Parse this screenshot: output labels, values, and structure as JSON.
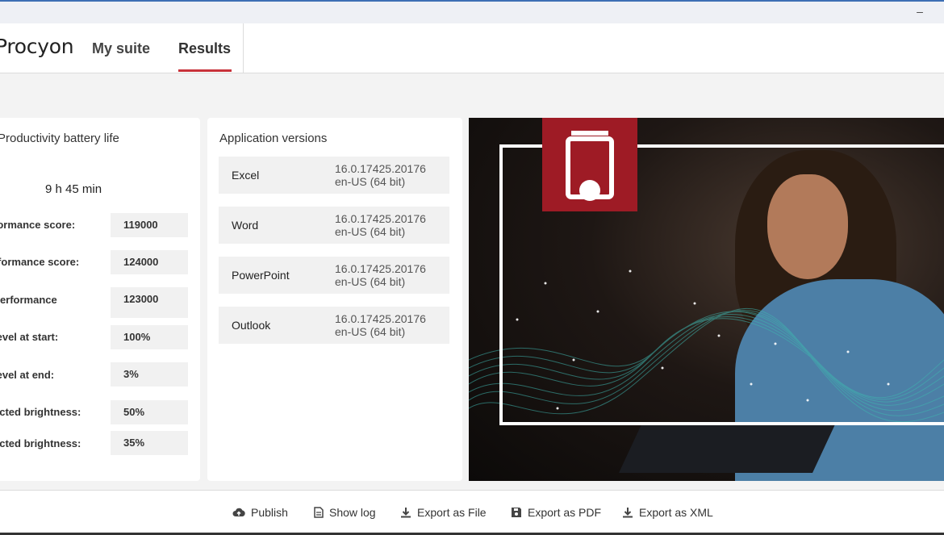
{
  "window": {
    "minimize_glyph": "–"
  },
  "nav": {
    "brand": "Procyon",
    "tabs": [
      {
        "label": "My suite"
      },
      {
        "label": "Results",
        "active": true
      }
    ]
  },
  "battery": {
    "title": "Productivity battery life",
    "duration": "9 h 45 min",
    "metrics": [
      {
        "label": "formance score:",
        "value": "119000"
      },
      {
        "label": "rformance score:",
        "value": "124000"
      },
      {
        "label": "performance",
        "value": "123000"
      },
      {
        "label": "level at start:",
        "value": "100%"
      },
      {
        "label": "level at end:",
        "value": "3%"
      },
      {
        "label": "ected brightness:",
        "value": "50%"
      },
      {
        "label": "ected brightness:",
        "value": "35%"
      }
    ]
  },
  "app_versions": {
    "title": "Application versions",
    "rows": [
      {
        "name": "Excel",
        "version": "16.0.17425.20176",
        "locale": "en-US (64 bit)"
      },
      {
        "name": "Word",
        "version": "16.0.17425.20176",
        "locale": "en-US (64 bit)"
      },
      {
        "name": "PowerPoint",
        "version": "16.0.17425.20176",
        "locale": "en-US (64 bit)"
      },
      {
        "name": "Outlook",
        "version": "16.0.17425.20176",
        "locale": "en-US (64 bit)"
      }
    ]
  },
  "hero": {
    "badge_icon": "battery-icon",
    "accent": "#9e1b25",
    "wave_color": "#3fb7b0"
  },
  "actions": [
    {
      "label": "Publish",
      "icon": "cloud-upload-icon"
    },
    {
      "label": "Show log",
      "icon": "document-icon"
    },
    {
      "label": "Export as File",
      "icon": "download-icon"
    },
    {
      "label": "Export as PDF",
      "icon": "save-icon"
    },
    {
      "label": "Export as XML",
      "icon": "download-icon"
    }
  ],
  "colors": {
    "tab_underline": "#c8323a",
    "title_line": "#3d6fb4"
  }
}
